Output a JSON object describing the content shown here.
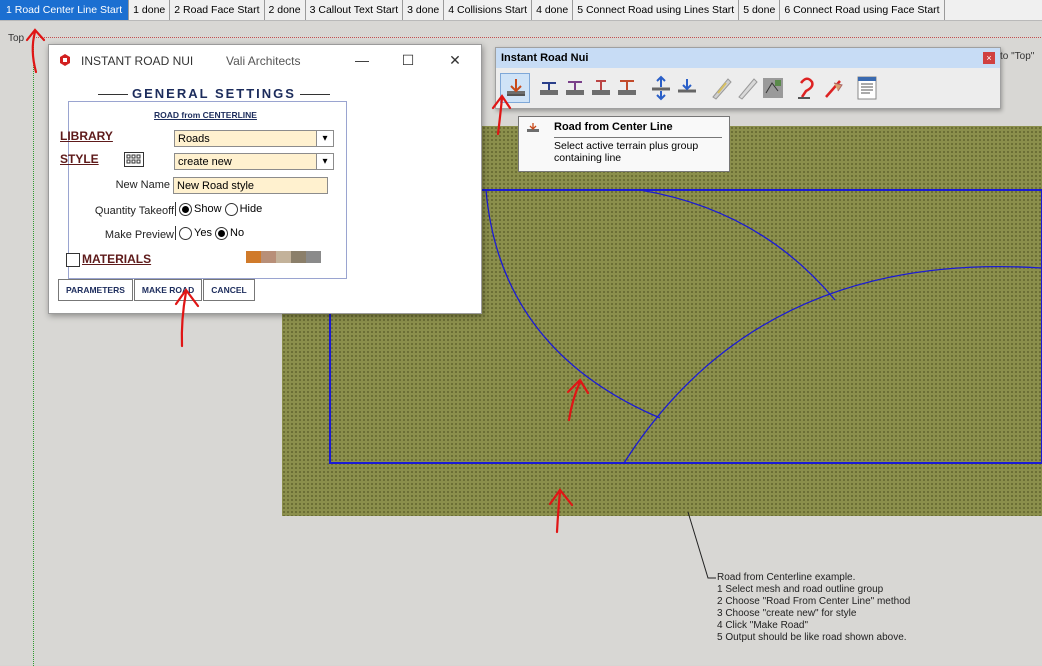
{
  "scene_tabs": [
    "1 Road Center Line Start",
    "1 done",
    "2 Road Face Start",
    "2 done",
    "3 Callout Text Start",
    "3 done",
    "4 Collisions Start",
    "4 done",
    "5 Connect Road using Lines Start",
    "5 done",
    "6 Connect Road using Face Start"
  ],
  "active_tab_index": 0,
  "view_label": "Top",
  "dialog": {
    "title": "INSTANT ROAD NUI",
    "subtitle": "Vali Architects",
    "heading": "GENERAL SETTINGS",
    "section": "ROAD from CENTERLINE",
    "library_label": "LIBRARY",
    "library_value": "Roads",
    "style_label": "STYLE",
    "style_value": "create new",
    "new_name_label": "New Name",
    "new_name_value": "New Road style",
    "quantity_label": "Quantity Takeoff",
    "quantity_show": "Show",
    "quantity_hide": "Hide",
    "quantity_selected": "Show",
    "preview_label": "Make Preview",
    "preview_yes": "Yes",
    "preview_no": "No",
    "preview_selected": "No",
    "materials_label": "MATERIALS",
    "materials_checked": false,
    "material_swatches": [
      "#d07a2a",
      "#b88f78",
      "#c3b29a",
      "#8b7f6a",
      "#8a8a8a"
    ],
    "buttons": {
      "parameters": "PARAMETERS",
      "make_road": "MAKE ROAD",
      "cancel": "CANCEL"
    }
  },
  "toolbar": {
    "title": "Instant Road Nui",
    "to_top": "to \"Top\"",
    "icons": [
      "road-from-center-line-icon",
      "road-from-face-icon",
      "road-callout-icon",
      "road-edit-icon",
      "road-edit2-icon",
      "raise-terrain-icon",
      "lower-terrain-icon",
      "connect-lines-icon",
      "connect-face-icon",
      "collisions-icon",
      "road-sign-icon",
      "road-sign2-icon",
      "properties-icon"
    ]
  },
  "tooltip": {
    "title": "Road from Center Line",
    "body": "Select active terrain plus group containing line"
  },
  "note": [
    "Road from Centerline example.",
    "1 Select mesh and road outline group",
    "2 Choose \"Road From Center Line\" method",
    "3 Choose \"create new\" for style",
    "4 Click \"Make Road\"",
    "5 Output should be like road shown above."
  ],
  "colors": {
    "accent_tab": "#1b6fd1",
    "terrain": "#8b8f4c",
    "road_line": "#1b1bd4",
    "annotation_red": "#e01515"
  }
}
